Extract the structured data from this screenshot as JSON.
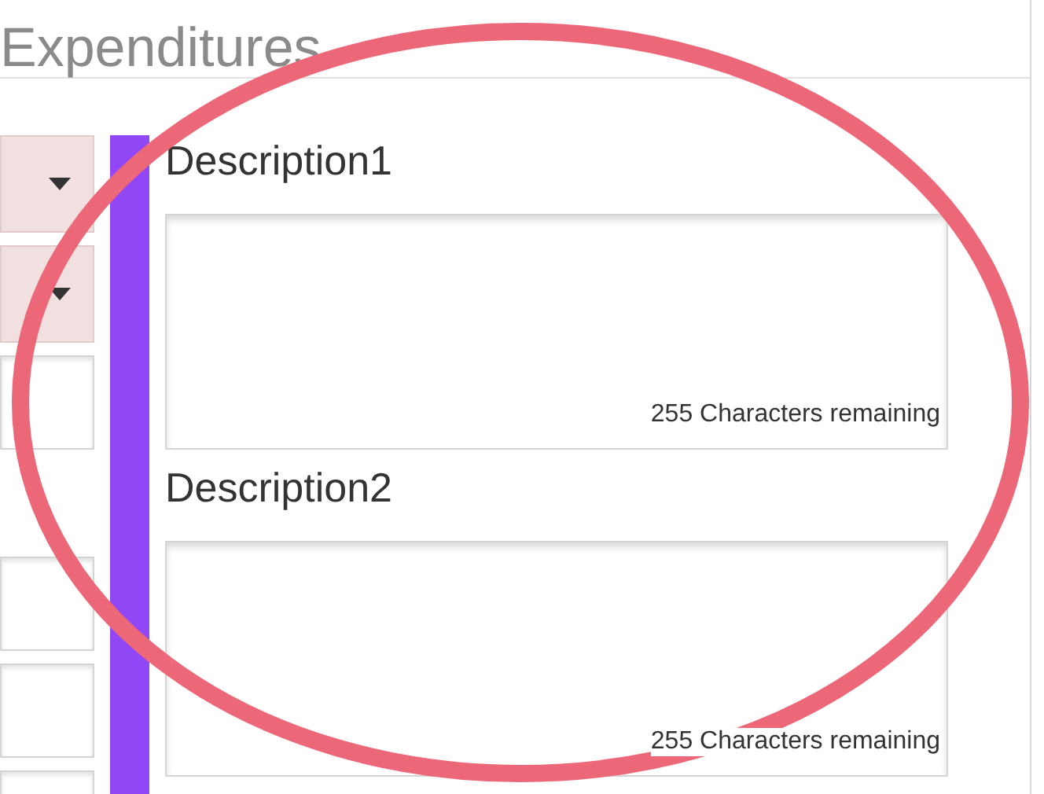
{
  "section": {
    "title": "Expenditures"
  },
  "left_fields": [
    {
      "kind": "dropdown"
    },
    {
      "kind": "dropdown"
    },
    {
      "kind": "input"
    },
    {
      "kind": "spacer"
    },
    {
      "kind": "input"
    },
    {
      "kind": "input"
    },
    {
      "kind": "input"
    }
  ],
  "descriptions": [
    {
      "label": "Description1",
      "counter": "255 Characters remaining"
    },
    {
      "label": "Description2",
      "counter": "255 Characters remaining"
    }
  ]
}
